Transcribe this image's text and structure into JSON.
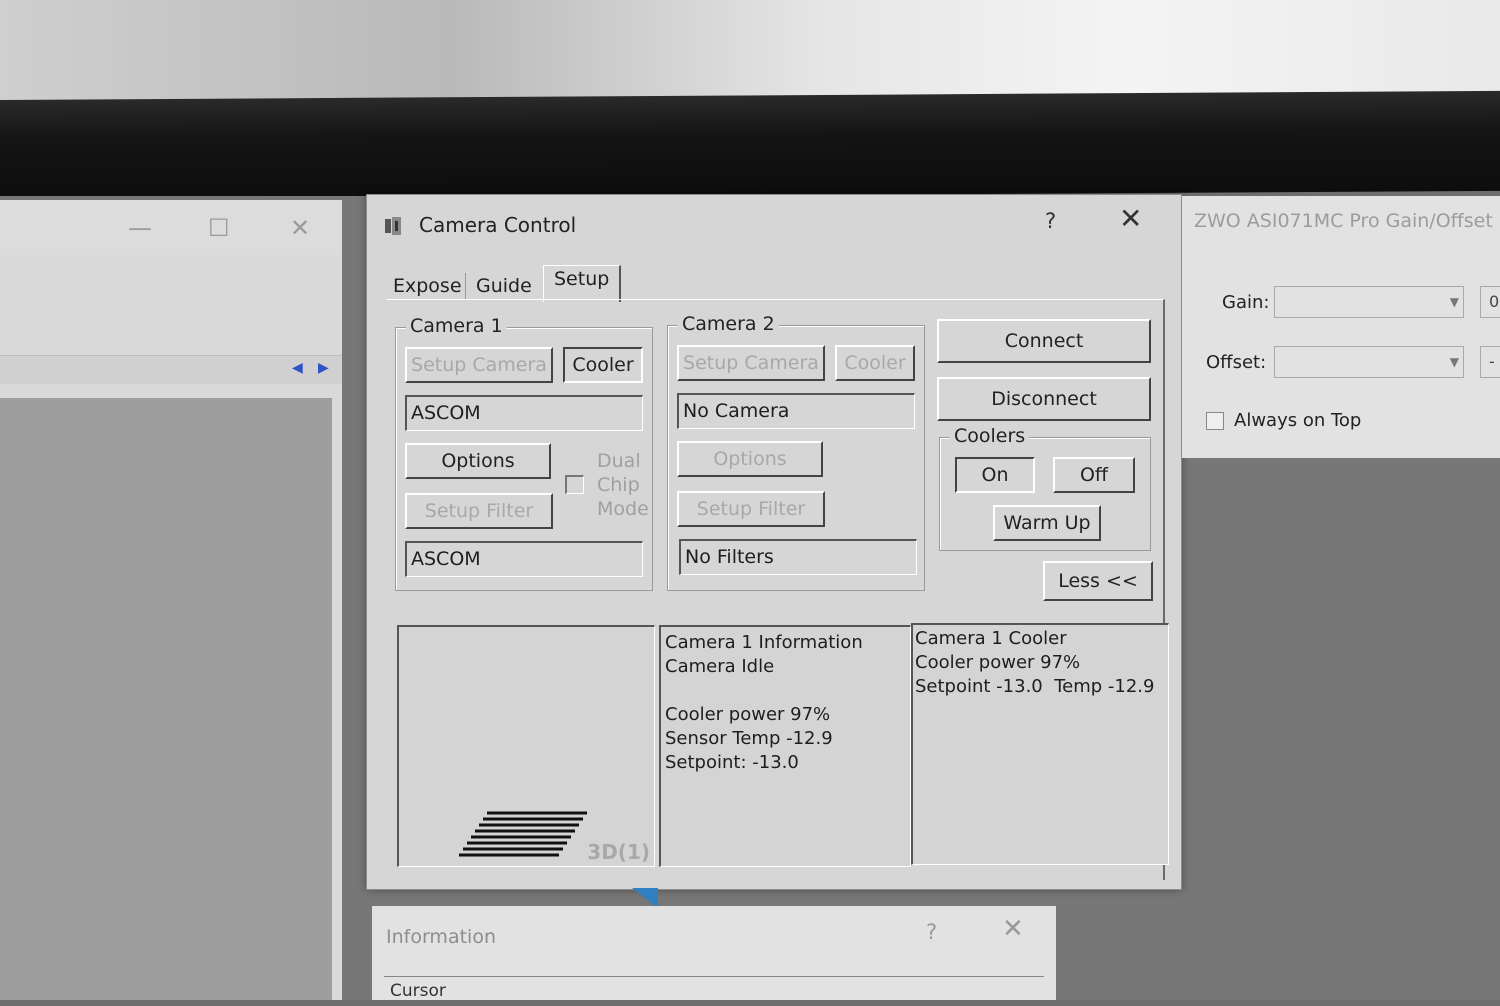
{
  "left_window": {
    "minimize_icon": "—",
    "maximize_icon": "☐",
    "close_icon": "✕"
  },
  "dialog": {
    "title": "Camera Control",
    "help": "?",
    "close": "✕",
    "tabs": [
      {
        "label": "Expose",
        "active": false
      },
      {
        "label": "Guide",
        "active": false
      },
      {
        "label": "Setup",
        "active": true
      }
    ],
    "camera1": {
      "label": "Camera 1",
      "setup_camera": "Setup Camera",
      "cooler": "Cooler",
      "camera_value": "ASCOM",
      "options": "Options",
      "setup_filter": "Setup Filter",
      "filter_value": "ASCOM",
      "dual": "Dual",
      "chip": "Chip",
      "mode": "Mode"
    },
    "camera2": {
      "label": "Camera 2",
      "setup_camera": "Setup Camera",
      "cooler": "Cooler",
      "camera_value": "No Camera",
      "options": "Options",
      "setup_filter": "Setup Filter",
      "filter_value": "No Filters"
    },
    "connect": "Connect",
    "disconnect": "Disconnect",
    "coolers": {
      "label": "Coolers",
      "on": "On",
      "off": "Off",
      "warm_up": "Warm Up"
    },
    "less": "Less <<",
    "badge": "3D(1)",
    "info_lines": [
      "Camera 1 Information",
      "Camera Idle",
      "",
      "Cooler power 97%",
      "Sensor Temp -12.9",
      "Setpoint: -13.0"
    ],
    "cooler_lines": [
      "Camera 1 Cooler",
      "Cooler power 97%",
      "Setpoint -13.0  Temp -12.9"
    ]
  },
  "gain_window": {
    "title": "ZWO ASI071MC Pro Gain/Offset",
    "gain_label": "Gain:",
    "offset_label": "Offset:",
    "gain_value": "0",
    "offset_value": "-",
    "always_on_top": "Always on Top"
  },
  "info_window": {
    "title": "Information",
    "help": "?",
    "close": "✕",
    "cursor": "Cursor"
  }
}
